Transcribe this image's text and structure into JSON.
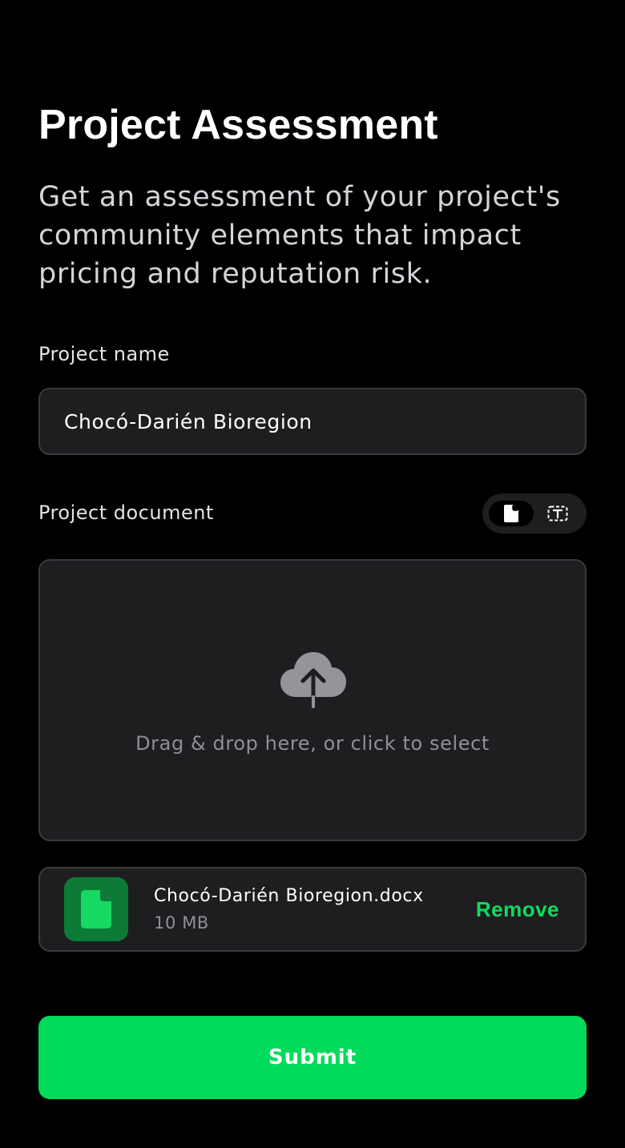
{
  "header": {
    "title": "Project Assessment",
    "subtitle": "Get an assessment of your project's community elements that impact pricing and reputation risk."
  },
  "project_name": {
    "label": "Project name",
    "value": "Chocó-Darién Bioregion"
  },
  "project_document": {
    "label": "Project document",
    "mode_toggle": {
      "options": [
        "file-icon",
        "text-icon"
      ],
      "selected": "file-icon"
    },
    "dropzone": {
      "icon": "cloud-upload-icon",
      "text": "Drag & drop here, or click to select"
    },
    "uploaded_file": {
      "icon": "file-icon",
      "name": "Chocó-Darién Bioregion.docx",
      "size": "10 MB",
      "remove_label": "Remove"
    }
  },
  "submit_label": "Submit",
  "colors": {
    "background": "#000000",
    "surface": "#1e1e21",
    "border": "#3a3a3f",
    "accent": "#00db5b",
    "file_icon_bg": "#0d7a37"
  }
}
